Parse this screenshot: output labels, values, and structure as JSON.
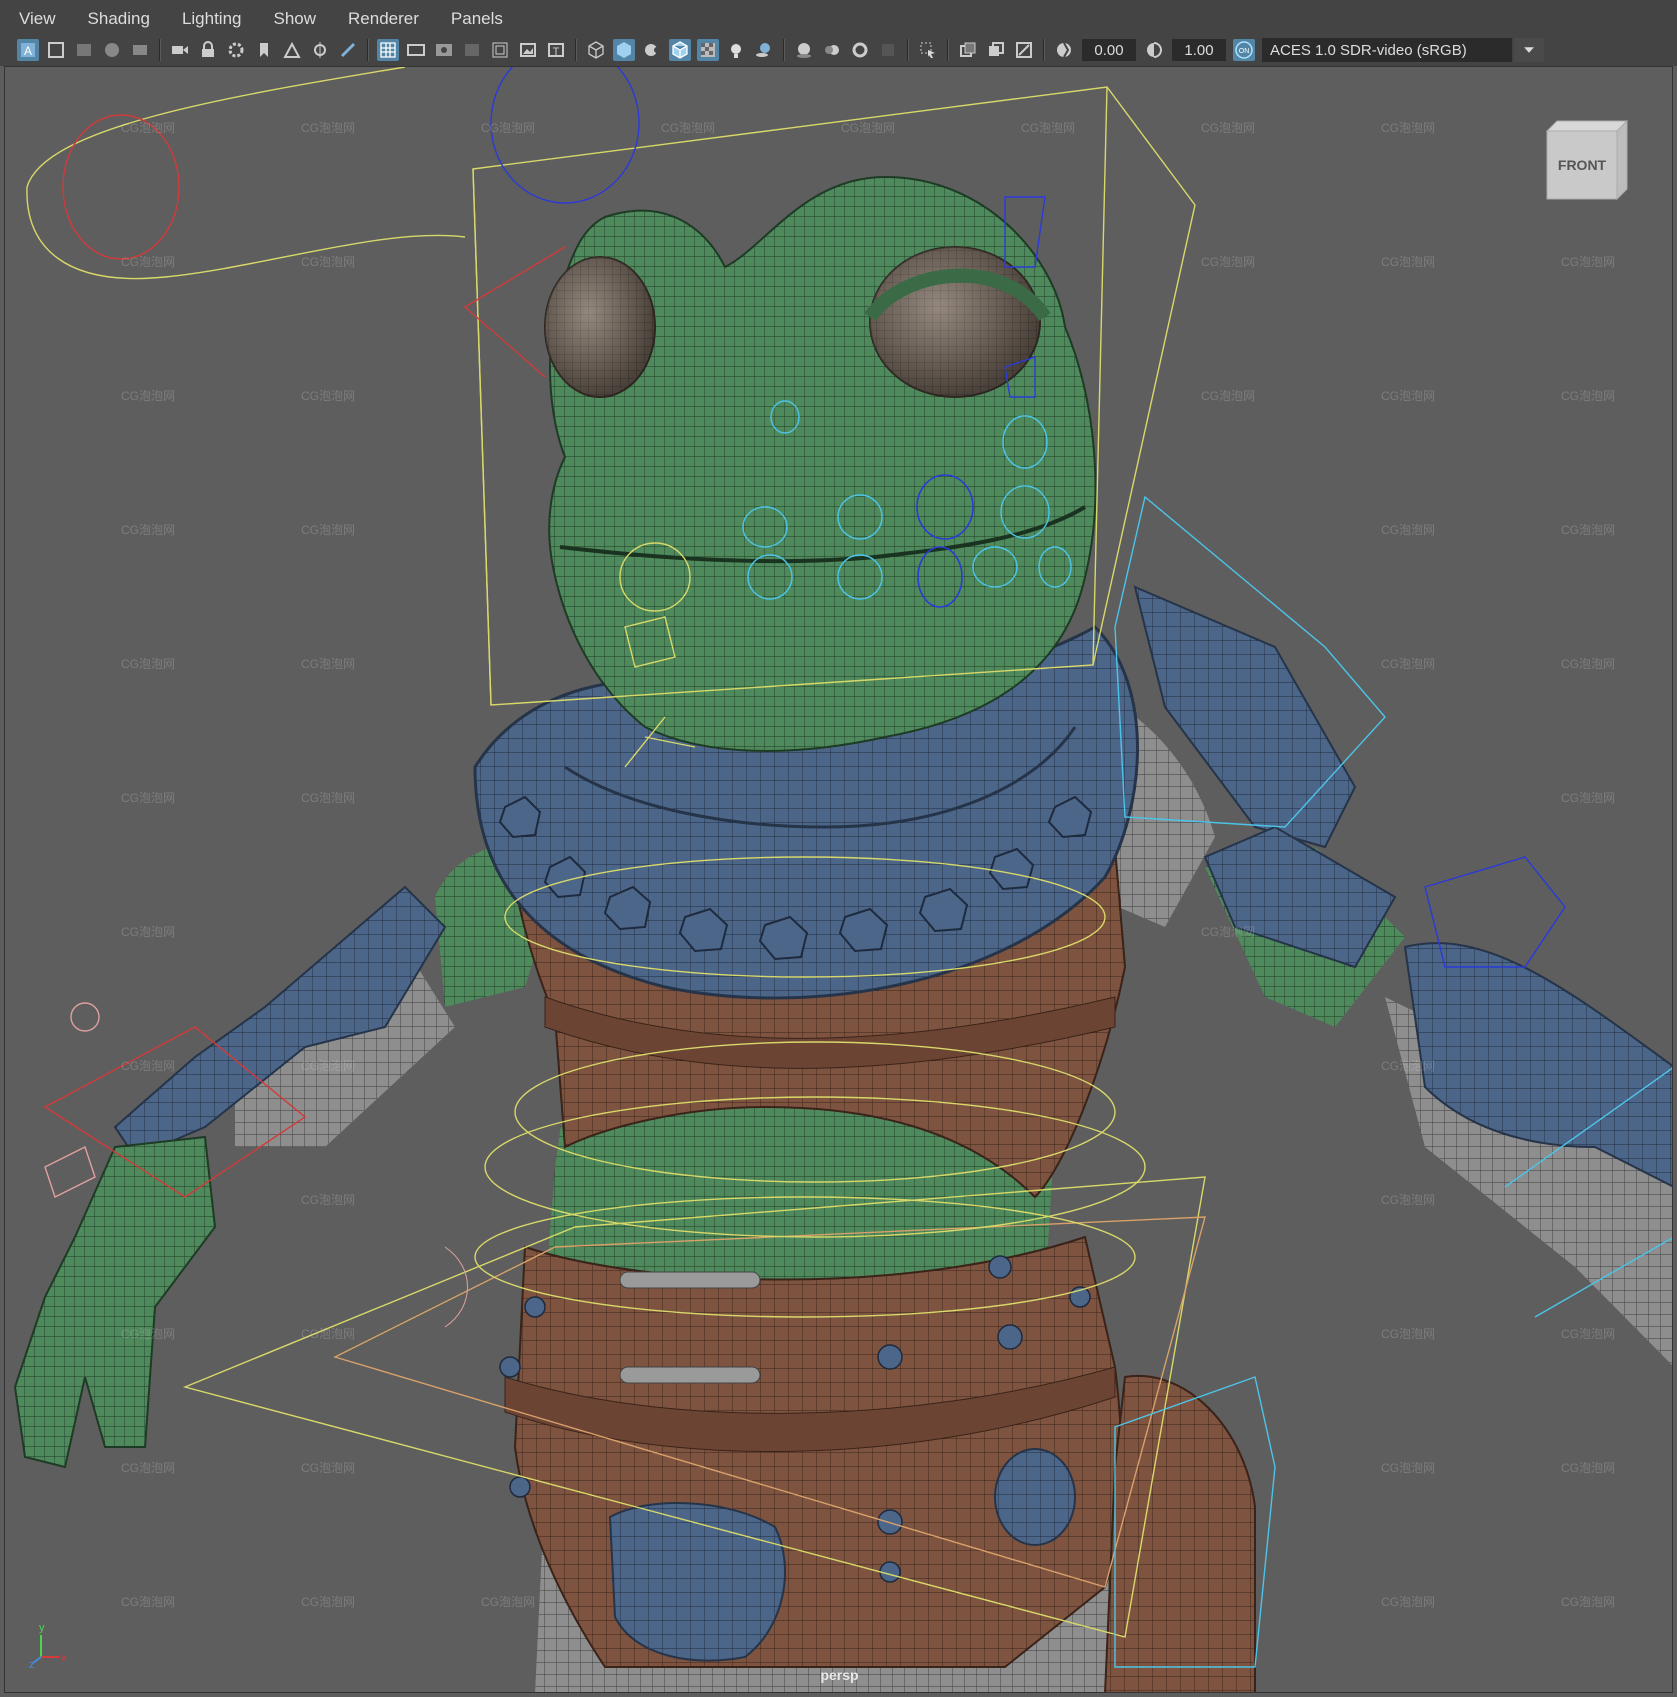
{
  "menu": [
    "View",
    "Shading",
    "Lighting",
    "Show",
    "Renderer",
    "Panels"
  ],
  "toolbar": {
    "exposure_value": "0.00",
    "gamma_value": "1.00",
    "color_management_toggle": "ON",
    "color_space": "ACES 1.0 SDR-video (sRGB)",
    "icons": [
      "select-camera-icon",
      "camera-attributes-icon",
      "bookmark-icon",
      "image-plane-icon",
      "2d-pan-zoom-icon",
      "grease-pencil-icon",
      "grid-icon",
      "film-gate-icon",
      "resolution-gate-icon",
      "gate-mask-icon",
      "field-chart-icon",
      "safe-action-icon",
      "safe-title-icon",
      "wireframe-icon",
      "smooth-shade-icon",
      "use-default-material-icon",
      "wireframe-on-shaded-icon",
      "xray-icon",
      "lighting-icon",
      "shadows-icon",
      "screen-space-ao-icon",
      "motion-blur-icon",
      "anti-aliasing-icon",
      "depth-of-field-icon",
      "isolate-select-icon",
      "xray-joints-icon",
      "xray-active-icon",
      "backface-culling-icon",
      "exposure-icon",
      "gamma-icon",
      "color-management-icon"
    ]
  },
  "viewport": {
    "camera_label": "persp",
    "viewcube_label": "FRONT",
    "watermark": "CG泡泡网",
    "axis": {
      "y": "y",
      "z": "z",
      "x": "x"
    }
  },
  "colors": {
    "menubar_bg": "#444444",
    "viewport_bg": "#5e5e5e",
    "skin": "#4f8a5c",
    "armor": "#4c6689",
    "leather": "#7e5440",
    "cloth": "#8d8d8d",
    "highlight": "#5285a6"
  }
}
